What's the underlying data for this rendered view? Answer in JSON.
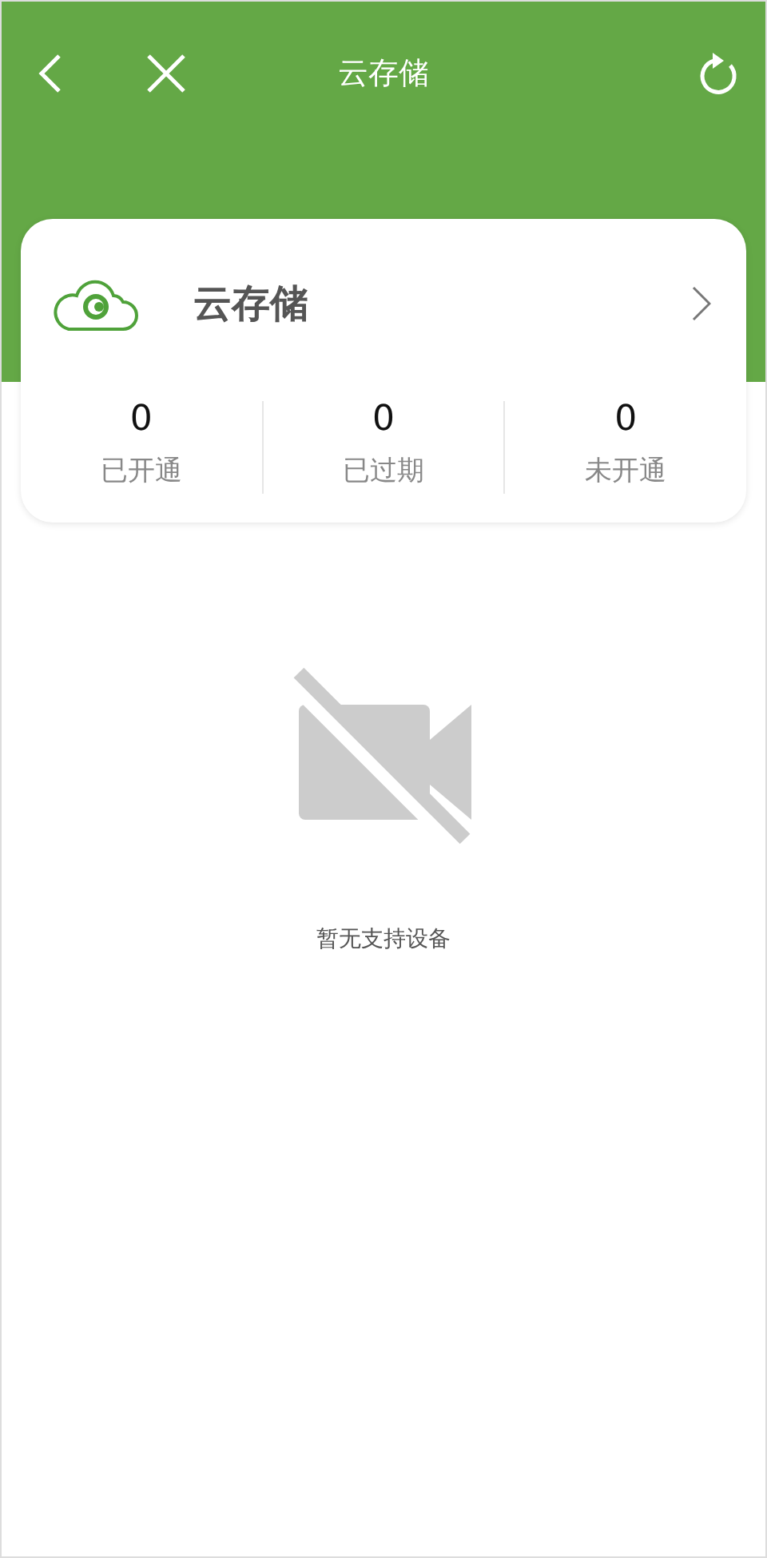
{
  "header": {
    "title": "云存储"
  },
  "card": {
    "title": "云存储",
    "stats": [
      {
        "value": "0",
        "label": "已开通"
      },
      {
        "value": "0",
        "label": "已过期"
      },
      {
        "value": "0",
        "label": "未开通"
      }
    ]
  },
  "empty": {
    "message": "暂无支持设备"
  }
}
